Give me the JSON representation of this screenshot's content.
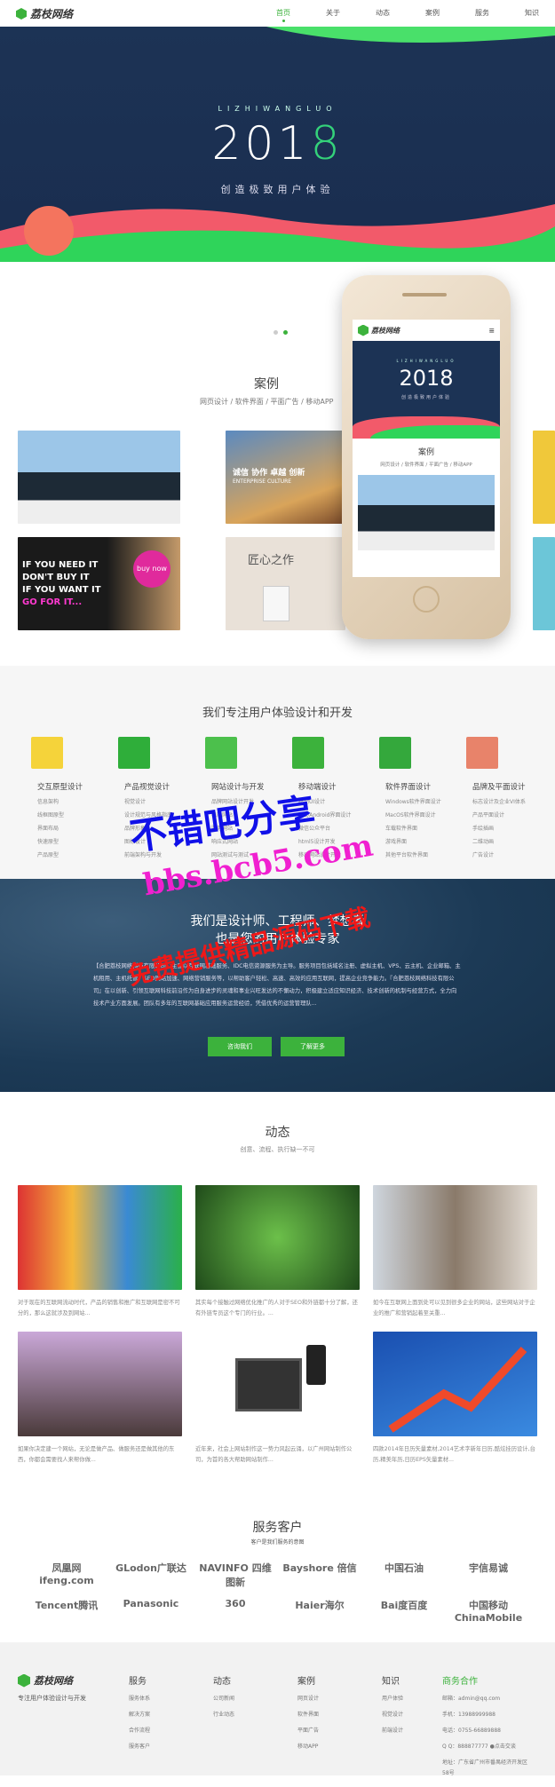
{
  "header": {
    "logo": "荔枝网络",
    "nav": [
      "首页",
      "关于",
      "动态",
      "案例",
      "服务",
      "知识"
    ],
    "active": 0
  },
  "hero": {
    "sub": "LIZHIWANGLUO",
    "year_a": "201",
    "year_b": "8",
    "slogan": "创造极致用户体验"
  },
  "cases": {
    "title": "案例",
    "filters": "网页设计 / 软件界面 / 平面广告 / 移动APP",
    "thumb_text": [
      "IF YOU NEED IT",
      "DON'T BUY IT",
      "IF YOU WANT IT",
      "GO FOR IT...",
      "buy now",
      "匠心之作",
      "诚信 协作 卓越 创新",
      "ENTERPRISE CULTURE"
    ],
    "phone": {
      "logo": "荔枝网络",
      "sub": "LIZHIWANGLUO",
      "year": "2018",
      "slogan": "创造极致用户体验",
      "title": "案例",
      "filters": "网页设计 / 软件界面 / 平面广告 / 移动APP"
    }
  },
  "services": {
    "title": "我们专注用户体验设计和开发",
    "items": [
      {
        "name": "交互原型设计",
        "color": "#f5d33a",
        "list": [
          "信息架构",
          "线框图原型",
          "界面布局",
          "快速原型",
          "产品原型"
        ]
      },
      {
        "name": "产品视觉设计",
        "color": "#2fae3a",
        "list": [
          "视觉设计",
          "设计规范与风格指南",
          "品牌形象",
          "图标设计",
          "前端架构与开发"
        ]
      },
      {
        "name": "网站设计与开发",
        "color": "#4cc04c",
        "list": [
          "品牌网站设计开发",
          "电商网站",
          "服务网站",
          "响应式网站",
          "网站测试与测试"
        ]
      },
      {
        "name": "移动端设计",
        "color": "#3cb23c",
        "list": [
          "移动UI设计",
          "iOS/Android界面设计",
          "微信公众平台",
          "html5设计开发",
          "移动网站设计开发"
        ]
      },
      {
        "name": "软件界面设计",
        "color": "#34a83c",
        "list": [
          "Windows软件界面设计",
          "MacOS软件界面设计",
          "车载软件界面",
          "游戏界面",
          "其他平台软件界面"
        ]
      },
      {
        "name": "品牌及平面设计",
        "color": "#e8836a",
        "list": [
          "标志设计及企业VI体系",
          "产品平面设计",
          "手绘插画",
          "二维动画",
          "广告设计"
        ]
      }
    ]
  },
  "about": {
    "line1": "我们是设计师、工程师、梦想者",
    "line2": "也是您的用户体验专家",
    "text": "【合肥荔枝网络科技有限公司】主要以互联网基础服务、IDC电信资源服务为主导。服务项目包括域名注册、虚拟主机、VPS、云主机、企业邮箱、主机租用、主机托管、SEO网站加速、网络营销服务等，以帮助客户轻松、高速、高效的应用互联网，提高企业竞争能力。『合肥荔枝网络科技有限公司』在以创新、引领互联网科技前沿作为自身进步的灵魂和事业兴旺发达的不懈动力，积极建立适应知识经济、技术创新的机制与经营方式，全力向技术产业方面发展。团队有多年的互联网基础应用服务运营经验，凭借优秀的运营管理队...",
    "btn1": "咨询我们",
    "btn2": "了解更多"
  },
  "news": {
    "title": "动态",
    "sub": "创意、流程、执行缺一不可",
    "items": [
      "对于现在的互联网流动时代，产品的销售和推广和互联网是密不可分的，那么这就涉及到网站...",
      "其实每个接触过网络优化推广的人对于SEO和外链都十分了解，还有外链专员这个专门的行业。...",
      "如今在互联网上面到处可以见到很多企业的网站，这些网站对于企业的推广和营销起着至关重...",
      "如果你决定建一个网站，无论是做产品、做服务还是做其他的东西，你都会需要找人来帮你做...",
      "近年来，社会上网站制作这一势力风起云涌，以广州网站制作公司，为首的各大帮助网站制作...",
      "四款2014年日历矢量素材,2014艺术字新年日历,酷炫挂历设计,台历,精美年历,日历EPS矢量素材..."
    ]
  },
  "clients": {
    "title": "服务客户",
    "sub": "客户是我们服务的意图",
    "logos": [
      "凤凰网 ifeng.com",
      "GLodon广联达",
      "NAVINFO 四维图新",
      "Bayshore 倍信",
      "中国石油",
      "宇信易诚",
      "Tencent腾讯",
      "Panasonic",
      "360",
      "Haier海尔",
      "Bai度百度",
      "中国移动 ChinaMobile"
    ]
  },
  "footer": {
    "logo": "荔枝网络",
    "tagline": "专注用户体验设计与开发",
    "cols": [
      {
        "title": "服务",
        "items": [
          "服务体系",
          "解决方案",
          "合作流程",
          "服务客户"
        ]
      },
      {
        "title": "动态",
        "items": [
          "公司新闻",
          "行业动态"
        ]
      },
      {
        "title": "案例",
        "items": [
          "网页设计",
          "软件界面",
          "平面广告",
          "移动APP"
        ]
      },
      {
        "title": "知识",
        "items": [
          "用户体验",
          "视觉设计",
          "前端设计"
        ]
      }
    ],
    "contact": {
      "title": "商务合作",
      "email": "邮箱：admin@qq.com",
      "mobile": "手机：13988999988",
      "tel": "电话：0755-66889888",
      "qq": "Q Q：888877777",
      "qq_btn": "点击交谈",
      "addr": "地址：广东省广州市番禺经济开发区58号"
    }
  },
  "watermark": {
    "w1": "不错吧分享",
    "w2": "bbs.bcb5.com",
    "w3": "免费提供精品源码下载"
  },
  "colors": {
    "accent": "#3cb23c",
    "hero_bg": "#1c3355",
    "about_bg": "#1c3a56"
  }
}
